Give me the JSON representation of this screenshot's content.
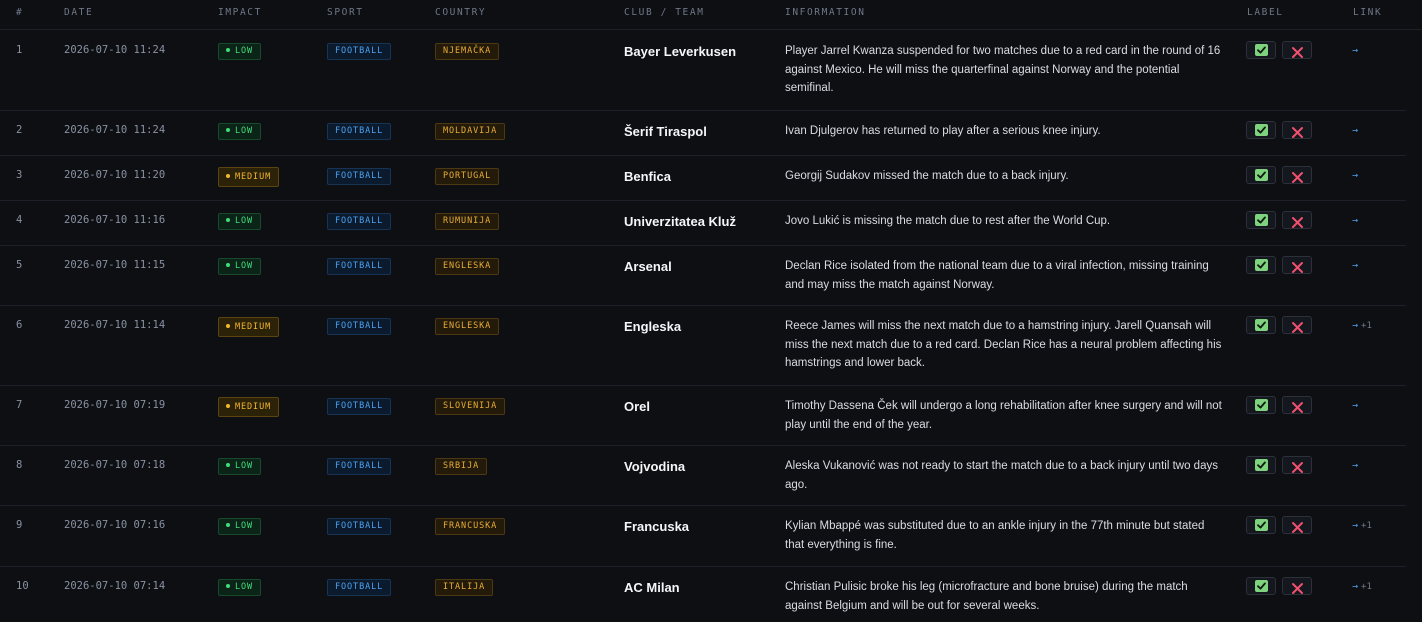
{
  "headers": {
    "num": "#",
    "date": "DATE",
    "impact": "IMPACT",
    "sport": "SPORT",
    "country": "COUNTRY",
    "club": "CLUB / TEAM",
    "information": "INFORMATION",
    "label": "LABEL",
    "link": "LINK"
  },
  "colors": {
    "impact_low": "#3fdc7d",
    "impact_medium": "#f2b632",
    "sport": "#4aa2f2",
    "country": "#e8ad36",
    "approve": "#7fd37e",
    "reject": "#f0506e"
  },
  "icons": {
    "approve": "check-square-icon",
    "reject": "x-icon",
    "link": "arrow-right-icon"
  },
  "rows": [
    {
      "num": "1",
      "date": "2026-07-10 11:24",
      "impact": "LOW",
      "sport": "FOOTBALL",
      "country": "NJEMAČKA",
      "club": "Bayer Leverkusen",
      "info": "Player Jarrel Kwanza suspended for two matches due to a red card in the round of 16 against Mexico. He will miss the quarterfinal against Norway and the potential semifinal.",
      "link": "→",
      "link_extra": ""
    },
    {
      "num": "2",
      "date": "2026-07-10 11:24",
      "impact": "LOW",
      "sport": "FOOTBALL",
      "country": "MOLDAVIJA",
      "club": "Šerif Tiraspol",
      "info": "Ivan Djulgerov has returned to play after a serious knee injury.",
      "link": "→",
      "link_extra": ""
    },
    {
      "num": "3",
      "date": "2026-07-10 11:20",
      "impact": "MEDIUM",
      "sport": "FOOTBALL",
      "country": "PORTUGAL",
      "club": "Benfica",
      "info": "Georgij Sudakov missed the match due to a back injury.",
      "link": "→",
      "link_extra": ""
    },
    {
      "num": "4",
      "date": "2026-07-10 11:16",
      "impact": "LOW",
      "sport": "FOOTBALL",
      "country": "RUMUNIJA",
      "club": "Univerzitatea Kluž",
      "info": "Jovo Lukić is missing the match due to rest after the World Cup.",
      "link": "→",
      "link_extra": ""
    },
    {
      "num": "5",
      "date": "2026-07-10 11:15",
      "impact": "LOW",
      "sport": "FOOTBALL",
      "country": "ENGLESKA",
      "club": "Arsenal",
      "info": "Declan Rice isolated from the national team due to a viral infection, missing training and may miss the match against Norway.",
      "link": "→",
      "link_extra": ""
    },
    {
      "num": "6",
      "date": "2026-07-10 11:14",
      "impact": "MEDIUM",
      "sport": "FOOTBALL",
      "country": "ENGLESKA",
      "club": "Engleska",
      "info": "Reece James will miss the next match due to a hamstring injury. Jarell Quansah will miss the next match due to a red card. Declan Rice has a neural problem affecting his hamstrings and lower back.",
      "link": "→",
      "link_extra": "+1"
    },
    {
      "num": "7",
      "date": "2026-07-10 07:19",
      "impact": "MEDIUM",
      "sport": "FOOTBALL",
      "country": "SLOVENIJA",
      "club": "Orel",
      "info": "Timothy Dassena Ček will undergo a long rehabilitation after knee surgery and will not play until the end of the year.",
      "link": "→",
      "link_extra": ""
    },
    {
      "num": "8",
      "date": "2026-07-10 07:18",
      "impact": "LOW",
      "sport": "FOOTBALL",
      "country": "SRBIJA",
      "club": "Vojvodina",
      "info": "Aleska Vukanović was not ready to start the match due to a back injury until two days ago.",
      "link": "→",
      "link_extra": ""
    },
    {
      "num": "9",
      "date": "2026-07-10 07:16",
      "impact": "LOW",
      "sport": "FOOTBALL",
      "country": "FRANCUSKA",
      "club": "Francuska",
      "info": "Kylian Mbappé was substituted due to an ankle injury in the 77th minute but stated that everything is fine.",
      "link": "→",
      "link_extra": "+1"
    },
    {
      "num": "10",
      "date": "2026-07-10 07:14",
      "impact": "LOW",
      "sport": "FOOTBALL",
      "country": "ITALIJA",
      "club": "AC Milan",
      "info": "Christian Pulisic broke his leg (microfracture and bone bruise) during the match against Belgium and will be out for several weeks.",
      "link": "→",
      "link_extra": "+1"
    }
  ]
}
